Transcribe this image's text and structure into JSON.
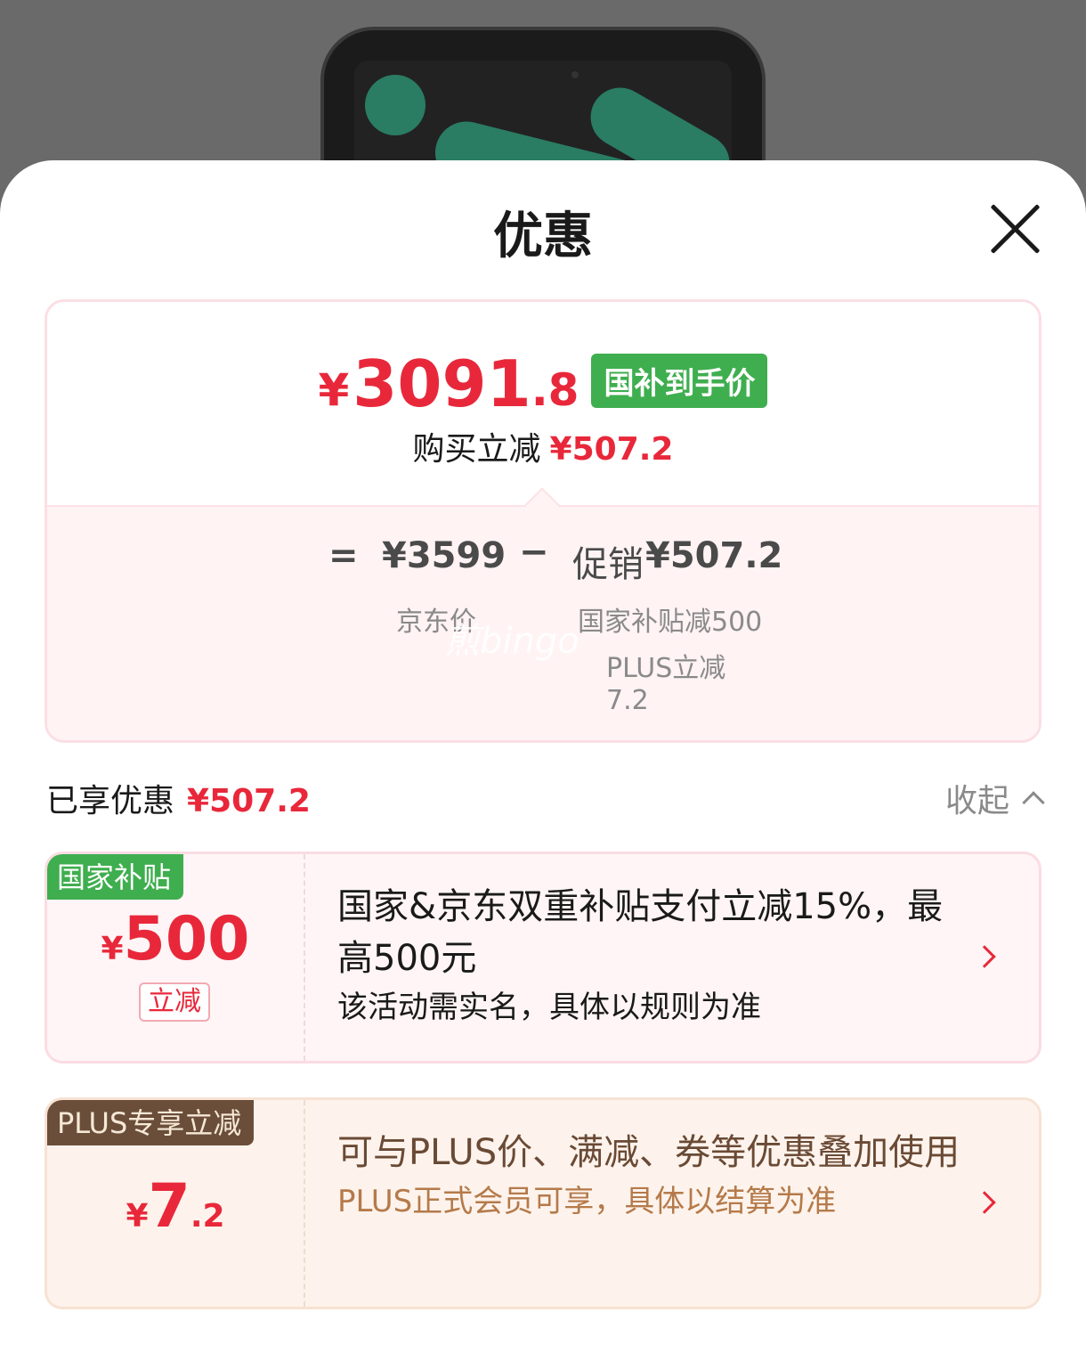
{
  "header": {
    "title": "优惠"
  },
  "price": {
    "currency": "¥",
    "integer": "3091",
    "decimal": ".8",
    "badge": "国补到手价",
    "reduce_label": "购买立减",
    "reduce_amount": "¥507.2"
  },
  "breakdown": {
    "equals": "=",
    "jd_price": "¥3599",
    "minus": "−",
    "promo_label": "促销",
    "promo_amount": "¥507.2",
    "jd_price_label": "京东价",
    "subsidy_line": "国家补贴减500",
    "plus_line_1": "PLUS立减",
    "plus_line_2": "7.2",
    "watermark": "煎bingo"
  },
  "enjoyed": {
    "label": "已享优惠",
    "amount": "¥507.2",
    "collapse_label": "收起"
  },
  "deals": [
    {
      "tag": "国家补贴",
      "currency": "¥",
      "amount": "500",
      "amount_decimal": "",
      "reduce_tag": "立减",
      "title": "国家&京东双重补贴支付立减15%，最高500元",
      "subtitle": "该活动需实名，具体以规则为准"
    },
    {
      "tag": "PLUS专享立减",
      "currency": "¥",
      "amount": "7",
      "amount_decimal": ".2",
      "title": "可与PLUS价、满减、券等优惠叠加使用",
      "subtitle": "PLUS正式会员可享，具体以结算为准"
    }
  ],
  "colors": {
    "accent": "#e8283a",
    "green": "#3fae4f",
    "plus_brown": "#6a4e3a"
  }
}
